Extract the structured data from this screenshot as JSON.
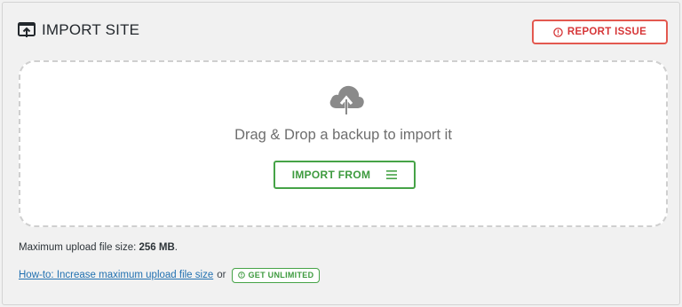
{
  "header": {
    "title": "IMPORT SITE",
    "icon": "import-upload-icon"
  },
  "report": {
    "label": "REPORT ISSUE",
    "icon": "alert-circle-icon",
    "color": "#d63638"
  },
  "dropzone": {
    "icon": "cloud-upload-icon",
    "text": "Drag & Drop a backup to import it",
    "button_label": "IMPORT FROM",
    "button_icon": "menu-icon",
    "accent": "#46a347"
  },
  "limits": {
    "label": "Maximum upload file size:",
    "value": "256 MB",
    "suffix": "."
  },
  "help": {
    "link_text": "How-to: Increase maximum upload file size",
    "or_text": "or",
    "badge_label": "GET UNLIMITED",
    "badge_icon": "info-circle-icon"
  }
}
